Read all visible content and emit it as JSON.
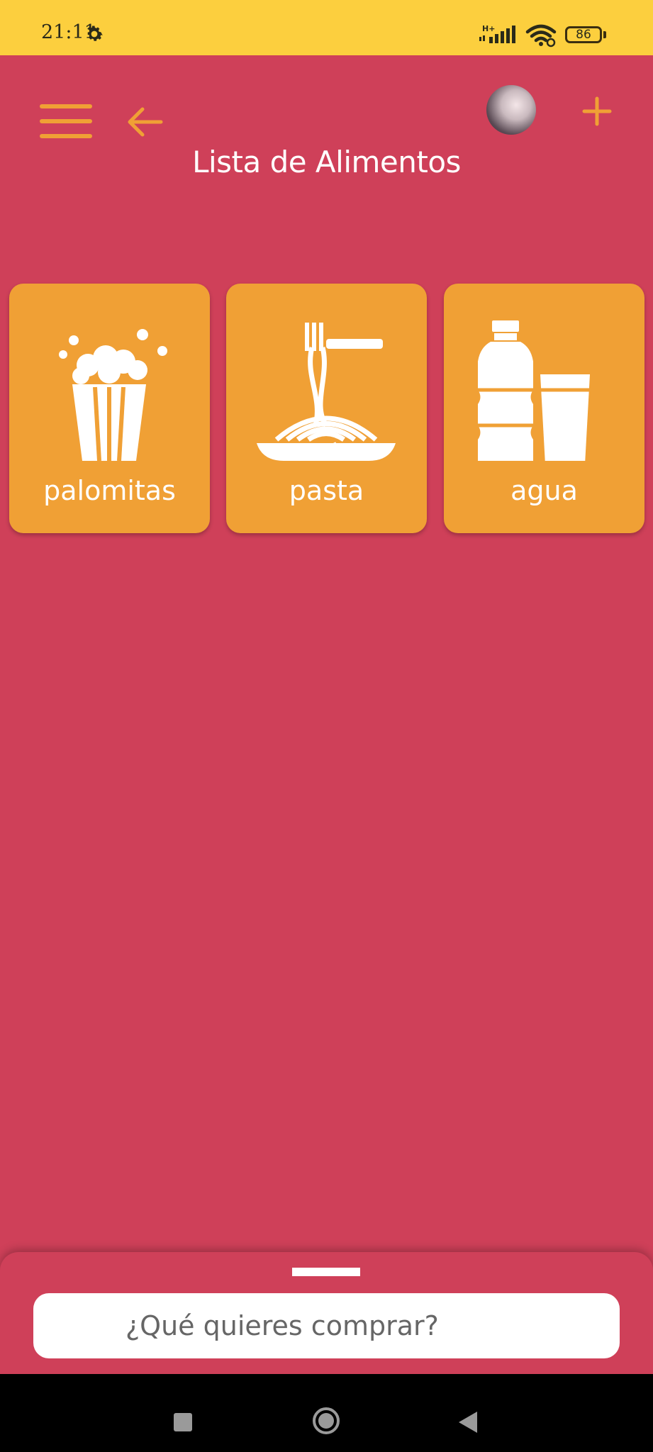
{
  "status_bar": {
    "time": "21:11",
    "network": "H+",
    "battery": "86",
    "icons": [
      "gear-icon",
      "signal-icon",
      "wifi-icon",
      "battery-icon"
    ]
  },
  "header": {
    "title": "Lista de Alimentos",
    "icons": [
      "menu-icon",
      "back-arrow-icon",
      "avatar",
      "plus-icon"
    ],
    "accent_color": "#F0A035"
  },
  "foods": [
    {
      "label": "palomitas",
      "icon": "popcorn-icon"
    },
    {
      "label": "pasta",
      "icon": "spaghetti-icon"
    },
    {
      "label": "agua",
      "icon": "water-bottle-icon"
    }
  ],
  "search": {
    "placeholder": "¿Qué quieres comprar?",
    "value": ""
  },
  "nav_bar": {
    "icons": [
      "recent-apps-icon",
      "home-icon",
      "back-icon"
    ]
  },
  "colors": {
    "background": "#CF4059",
    "status_bar": "#FCCF3E",
    "card": "#F0A035",
    "text": "#FFFFFF"
  }
}
